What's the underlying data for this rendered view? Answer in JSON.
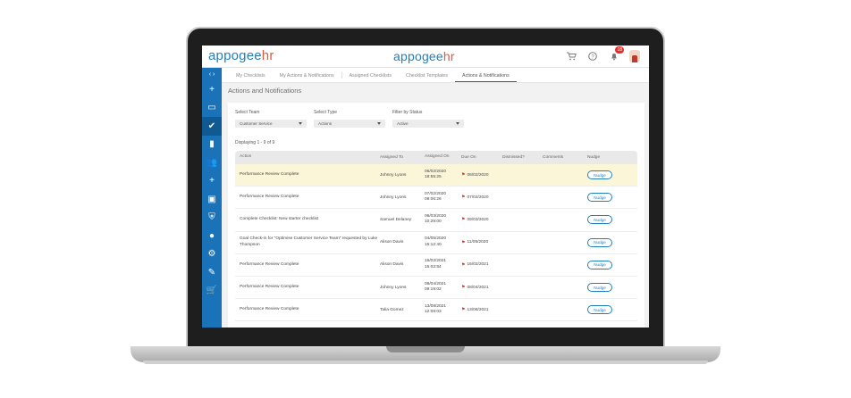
{
  "brand": {
    "left": {
      "part1": "appogee",
      "part2": "hr"
    },
    "center": {
      "part1": "appogee",
      "part2": "hr"
    }
  },
  "header": {
    "icons": [
      "cart-icon",
      "help-icon",
      "bell-icon",
      "avatar"
    ],
    "notification_count": "18"
  },
  "sidebar": {
    "toggle": "‹ ›",
    "items": [
      {
        "name": "add-icon",
        "glyph": "+"
      },
      {
        "name": "devices-icon",
        "glyph": "▭"
      },
      {
        "name": "checklist-icon",
        "glyph": "✔",
        "active": true
      },
      {
        "name": "reports-icon",
        "glyph": "▮"
      },
      {
        "name": "team-icon",
        "glyph": "👥"
      },
      {
        "name": "add-person-icon",
        "glyph": "+"
      },
      {
        "name": "id-card-icon",
        "glyph": "▣"
      },
      {
        "name": "shield-icon",
        "glyph": "⛨"
      },
      {
        "name": "account-icon",
        "glyph": "●"
      },
      {
        "name": "settings-icon",
        "glyph": "⚙"
      },
      {
        "name": "tools-icon",
        "glyph": "✎"
      },
      {
        "name": "cart-icon",
        "glyph": "🛒"
      }
    ]
  },
  "tabs": [
    {
      "label": "My Checklists",
      "active": false
    },
    {
      "label": "My Actions & Notifications",
      "active": false
    },
    {
      "label": "Assigned Checklists",
      "active": false
    },
    {
      "label": "Checklist Templates",
      "active": false
    },
    {
      "label": "Actions & Notifications",
      "active": true
    }
  ],
  "page": {
    "title": "Actions and Notifications"
  },
  "filters": {
    "team": {
      "label": "Select Team",
      "value": "Customer Service"
    },
    "type": {
      "label": "Select Type",
      "value": "Actions"
    },
    "status": {
      "label": "Filter by Status",
      "value": "Active"
    }
  },
  "displaying": "Displaying 1 - 9 of 9",
  "table": {
    "headers": [
      "Action",
      "Assigned To",
      "Assigned On",
      "Due On",
      "Dismissed?",
      "Comments",
      "Nudge"
    ],
    "nudge_label": "Nudge",
    "rows": [
      {
        "action": "Performance Review Complete",
        "assigned_to": "Johnny Lyons",
        "assigned_on_date": "06/02/2020",
        "assigned_on_time": "18:55:25",
        "due_on": "06/02/2020",
        "highlight": true
      },
      {
        "action": "Performance Review Complete",
        "assigned_to": "Johnny Lyons",
        "assigned_on_date": "07/02/2020",
        "assigned_on_time": "09:06:26",
        "due_on": "07/02/2020"
      },
      {
        "action": "Complete Checklist: New starter checklist",
        "assigned_to": "Samuel Delaney",
        "assigned_on_date": "06/03/2020",
        "assigned_on_time": "10:29:00",
        "due_on": "09/03/2020"
      },
      {
        "action": "Goal Check-in for \"Optimise Customer Service Team\" requested by Luke Thompson",
        "assigned_to": "Alison Davis",
        "assigned_on_date": "04/05/2020",
        "assigned_on_time": "15:12:40",
        "due_on": "11/05/2020"
      },
      {
        "action": "Performance Review Complete",
        "assigned_to": "Alison Davis",
        "assigned_on_date": "16/02/2021",
        "assigned_on_time": "15:02:54",
        "due_on": "16/02/2021"
      },
      {
        "action": "Performance Review Complete",
        "assigned_to": "Johnny Lyons",
        "assigned_on_date": "08/04/2021",
        "assigned_on_time": "09:19:02",
        "due_on": "08/04/2021"
      },
      {
        "action": "Performance Review Complete",
        "assigned_to": "Talia Gomez",
        "assigned_on_date": "13/08/2021",
        "assigned_on_time": "12:09:03",
        "due_on": "13/08/2021"
      }
    ]
  },
  "colors": {
    "brand_blue": "#1f7fbf",
    "brand_orange": "#e2573f",
    "sidebar": "#1a73b8",
    "highlight_row": "#fcf6d9",
    "due_flag": "#d9342b"
  }
}
